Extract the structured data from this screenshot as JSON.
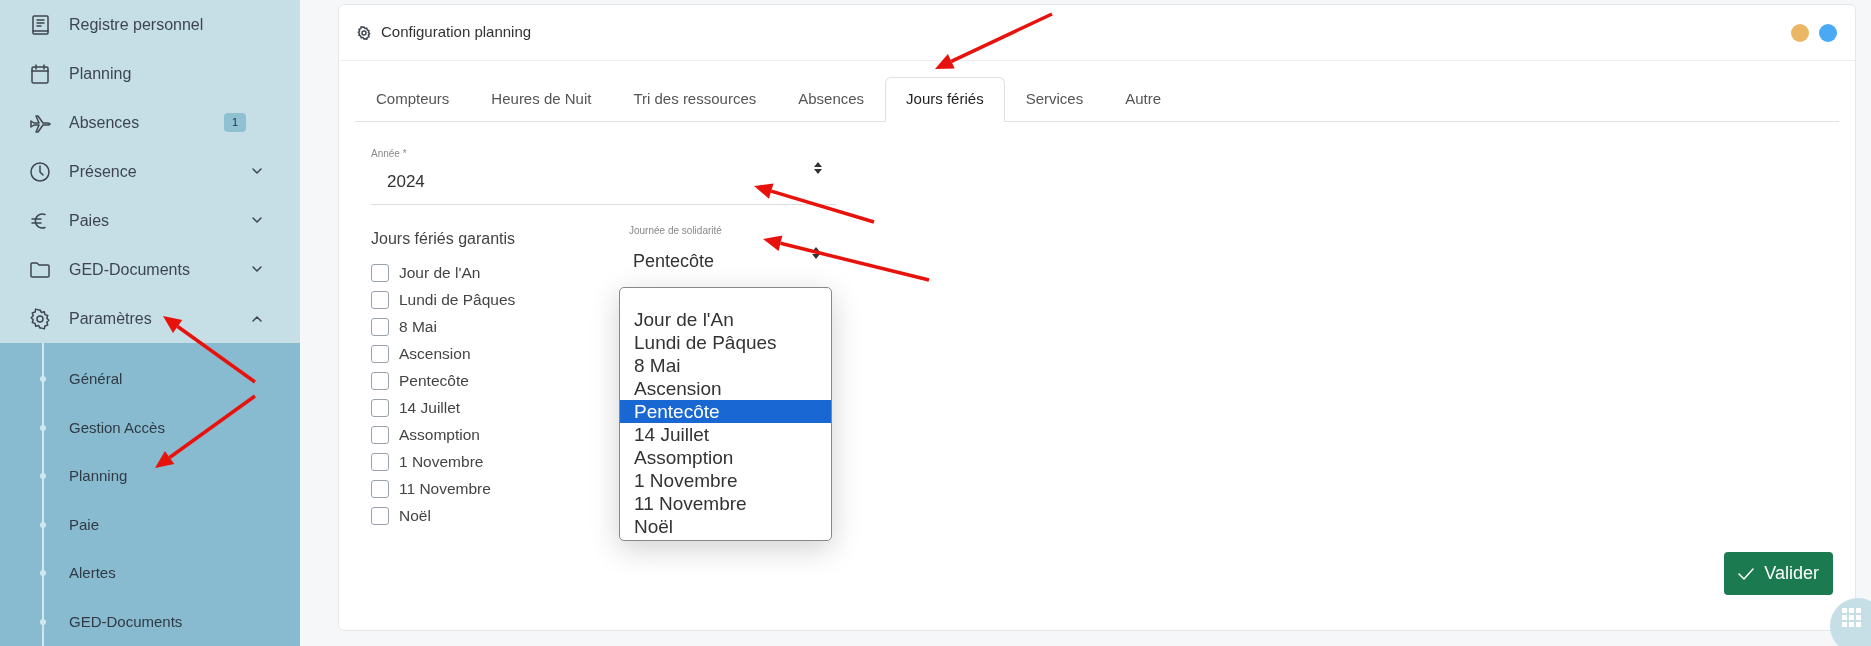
{
  "sidebar": {
    "items": [
      {
        "label": "Registre personnel"
      },
      {
        "label": "Planning"
      },
      {
        "label": "Absences",
        "badge": "1"
      },
      {
        "label": "Présence",
        "expanded": false
      },
      {
        "label": "Paies",
        "expanded": false
      },
      {
        "label": "GED-Documents",
        "expanded": false
      },
      {
        "label": "Paramètres",
        "expanded": true,
        "children": [
          {
            "label": "Général"
          },
          {
            "label": "Gestion Accès"
          },
          {
            "label": "Planning"
          },
          {
            "label": "Paie"
          },
          {
            "label": "Alertes"
          },
          {
            "label": "GED-Documents"
          }
        ]
      }
    ]
  },
  "card": {
    "title": "Configuration planning",
    "status_dots": [
      {
        "color": "#ebb765"
      },
      {
        "color": "#4aa9f4"
      }
    ],
    "tabs": [
      {
        "label": "Compteurs",
        "selected": false
      },
      {
        "label": "Heures de Nuit",
        "selected": false
      },
      {
        "label": "Tri des ressources",
        "selected": false
      },
      {
        "label": "Absences",
        "selected": false
      },
      {
        "label": "Jours fériés",
        "selected": true
      },
      {
        "label": "Services",
        "selected": false
      },
      {
        "label": "Autre",
        "selected": false
      }
    ],
    "year_field": {
      "label": "Année *",
      "value": "2024"
    },
    "guaranteed_holidays": {
      "title": "Jours fériés garantis",
      "items": [
        {
          "label": "Jour de l'An",
          "checked": false
        },
        {
          "label": "Lundi de Pâques",
          "checked": false
        },
        {
          "label": "8 Mai",
          "checked": false
        },
        {
          "label": "Ascension",
          "checked": false
        },
        {
          "label": "Pentecôte",
          "checked": false
        },
        {
          "label": "14 Juillet",
          "checked": false
        },
        {
          "label": "Assomption",
          "checked": false
        },
        {
          "label": "1 Novembre",
          "checked": false
        },
        {
          "label": "11 Novembre",
          "checked": false
        },
        {
          "label": "Noël",
          "checked": false
        }
      ]
    },
    "solidarity_day": {
      "label": "Journée de solidarité",
      "value": "Pentecôte",
      "options": [
        {
          "label": "Jour de l'An",
          "selected": false
        },
        {
          "label": "Lundi de Pâques",
          "selected": false
        },
        {
          "label": "8 Mai",
          "selected": false
        },
        {
          "label": "Ascension",
          "selected": false
        },
        {
          "label": "Pentecôte",
          "selected": true
        },
        {
          "label": "14 Juillet",
          "selected": false
        },
        {
          "label": "Assomption",
          "selected": false
        },
        {
          "label": "1 Novembre",
          "selected": false
        },
        {
          "label": "11 Novembre",
          "selected": false
        },
        {
          "label": "Noël",
          "selected": false
        }
      ]
    },
    "submit_button": "Valider"
  }
}
